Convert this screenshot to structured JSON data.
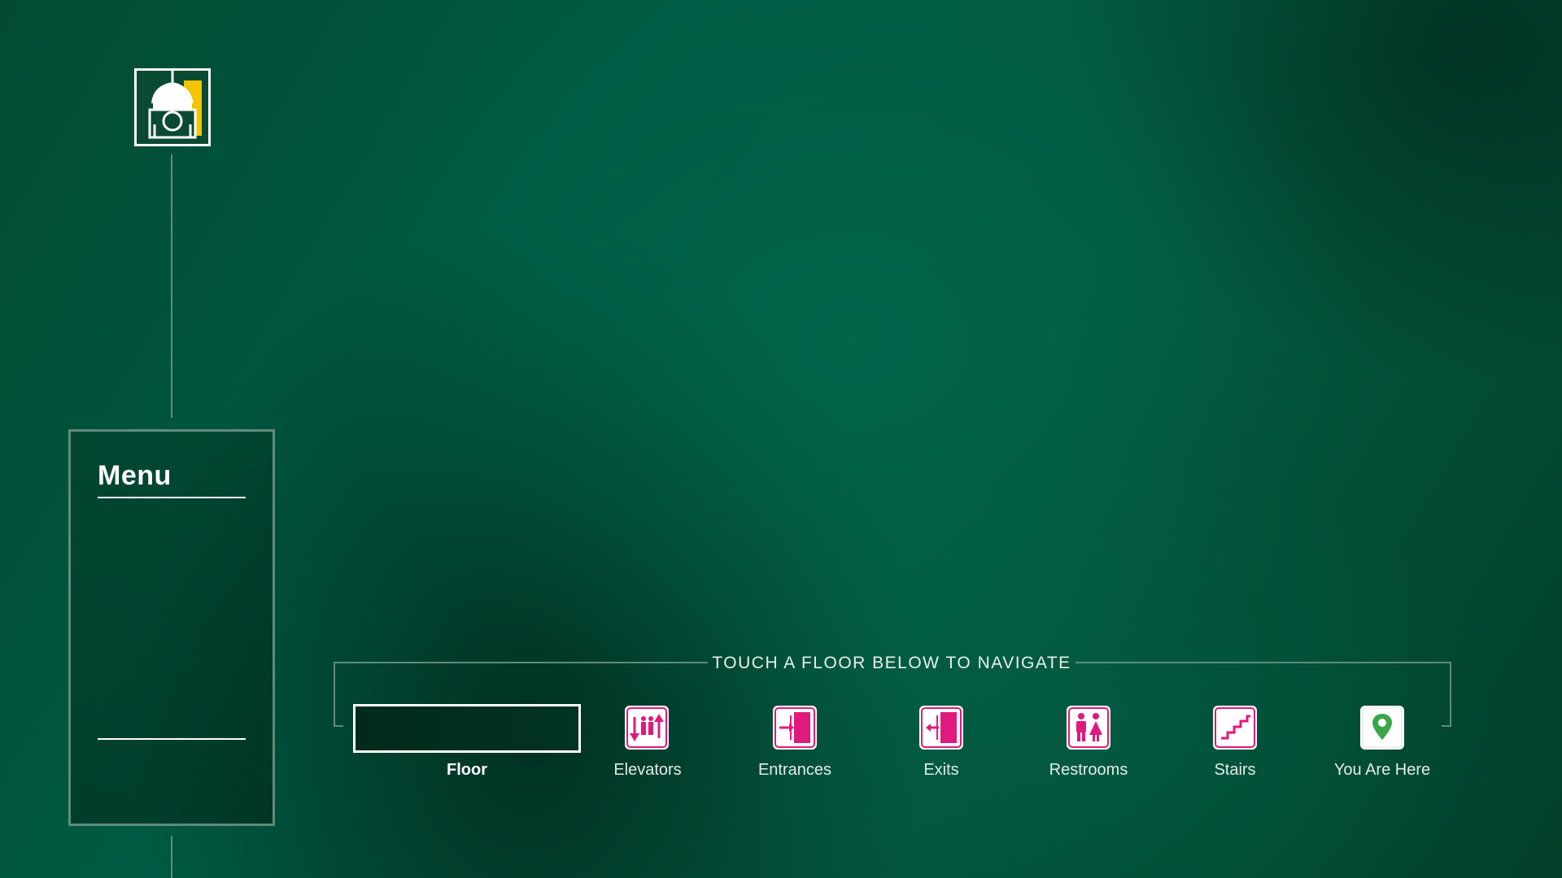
{
  "header": {
    "logo_icon": "university-clock-tower-logo"
  },
  "menu": {
    "title": "Menu"
  },
  "navigation": {
    "heading": "TOUCH A FLOOR BELOW TO NAVIGATE",
    "floor_label": "Floor",
    "legend": [
      {
        "label": "Elevators",
        "icon": "elevator-icon"
      },
      {
        "label": "Entrances",
        "icon": "entrance-icon"
      },
      {
        "label": "Exits",
        "icon": "exit-icon"
      },
      {
        "label": "Restrooms",
        "icon": "restroom-icon"
      },
      {
        "label": "Stairs",
        "icon": "stairs-icon"
      },
      {
        "label": "You Are Here",
        "icon": "you-are-here-pin-icon"
      }
    ]
  },
  "colors": {
    "accent_pink": "#e0197d",
    "pin_green": "#3aa64a",
    "logo_gold": "#f2c500",
    "frame_line": "#5f8c7c"
  }
}
